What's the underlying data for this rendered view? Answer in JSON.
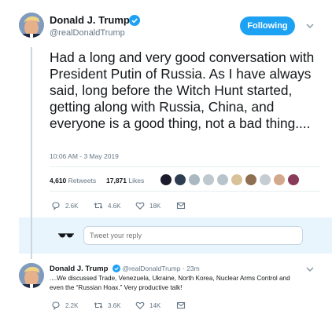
{
  "main_tweet": {
    "author_name": "Donald J. Trump",
    "author_handle": "@realDonaldTrump",
    "follow_label": "Following",
    "text": "Had a long and very good conversation with President Putin of Russia. As I have always said, long before the Witch Hunt started, getting along with Russia, China, and everyone is a good thing, not a bad thing....",
    "timestamp": "10:06 AM - 3 May 2019",
    "retweets_count": "4,610",
    "retweets_label": "Retweets",
    "likes_count": "17,871",
    "likes_label": "Likes",
    "actions": {
      "replies": "2.6K",
      "retweets": "4.6K",
      "likes": "18K"
    }
  },
  "reply_composer": {
    "placeholder": "Tweet your reply"
  },
  "thread_tweet": {
    "author_name": "Donald J. Trump",
    "author_handle": "@realDonaldTrump",
    "time": "· 23m",
    "text": "....We discussed Trade, Venezuela, Ukraine, North Korea, Nuclear Arms Control and even the “Russian Hoax.” Very productive talk!",
    "actions": {
      "replies": "2.2K",
      "retweets": "3.6K",
      "likes": "14K"
    }
  },
  "colors": {
    "accent": "#1da1f2",
    "text": "#14171a",
    "muted": "#657786"
  },
  "icons": [
    "verified-badge-icon",
    "chevron-down-icon",
    "reply-icon",
    "retweet-icon",
    "like-icon",
    "direct-message-icon",
    "sunglasses-icon"
  ]
}
